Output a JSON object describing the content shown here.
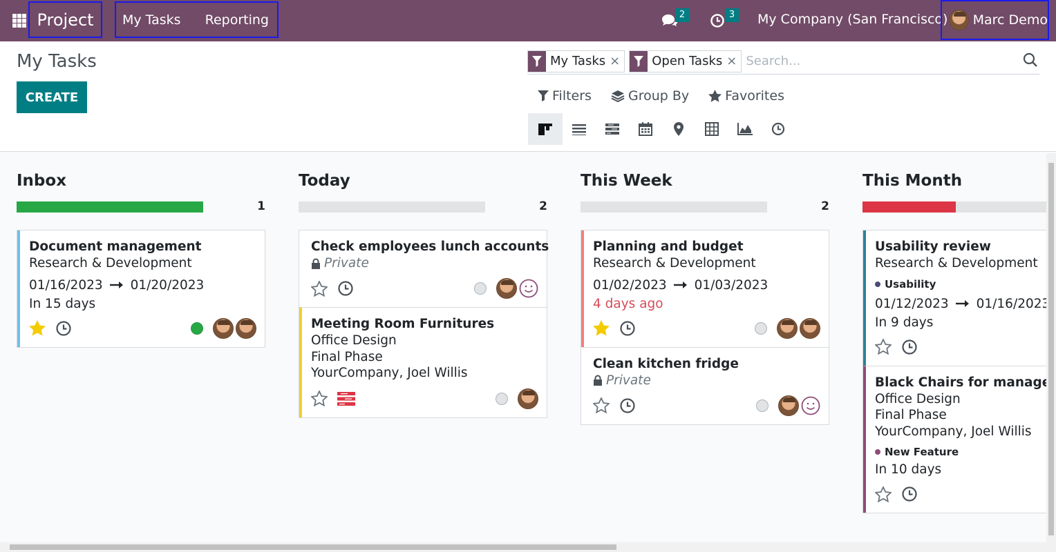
{
  "navbar": {
    "brand": "Project",
    "menu": [
      "My Tasks",
      "Reporting"
    ],
    "messages_count": "2",
    "activities_count": "3",
    "company": "My Company (San Francisco)",
    "user": "Marc Demo",
    "icons": [
      "apps-grid-icon",
      "chat-icon",
      "clock-icon"
    ]
  },
  "control_panel": {
    "title": "My Tasks",
    "create_label": "CREATE",
    "facets": [
      "My Tasks",
      "Open Tasks"
    ],
    "search_placeholder": "Search...",
    "filters_label": "Filters",
    "groupby_label": "Group By",
    "favorites_label": "Favorites",
    "views": [
      "kanban",
      "list",
      "gantt",
      "calendar",
      "map",
      "pivot",
      "graph",
      "activity"
    ],
    "active_view": "kanban"
  },
  "columns": [
    {
      "title": "Inbox",
      "count": "1",
      "progress": [
        {
          "color": "#28a745",
          "fraction": 1.0
        }
      ],
      "cards": [
        {
          "title": "Document management",
          "lines": [
            "Research & Development"
          ],
          "date_start": "01/16/2023",
          "date_end": "01/20/2023",
          "deadline": "In 15 days",
          "starred": true,
          "state": "green",
          "avatars": 2,
          "accent": "#6cc1ed"
        }
      ]
    },
    {
      "title": "Today",
      "count": "2",
      "progress": [],
      "cards": [
        {
          "title": "Check employees lunch accounts",
          "private": "Private",
          "starred": false,
          "state": "grey",
          "avatars": 1,
          "smiley": true,
          "accent": "transparent"
        },
        {
          "title": "Meeting Room Furnitures",
          "lines": [
            "Office Design",
            "Final Phase",
            "YourCompany, Joel Willis"
          ],
          "starred": false,
          "state": "grey",
          "avatars": 1,
          "gantt_icon": true,
          "accent": "#f4cf2c"
        }
      ]
    },
    {
      "title": "This Week",
      "count": "2",
      "progress": [],
      "cards": [
        {
          "title": "Planning and budget",
          "lines": [
            "Research & Development"
          ],
          "date_start": "01/02/2023",
          "date_end": "01/03/2023",
          "deadline": "4 days ago",
          "overdue": true,
          "starred": true,
          "state": "grey",
          "avatars": 2,
          "accent": "#f08080"
        },
        {
          "title": "Clean kitchen fridge",
          "private": "Private",
          "starred": false,
          "state": "grey",
          "avatars": 1,
          "smiley": true,
          "accent": "transparent"
        }
      ]
    },
    {
      "title": "This Month",
      "count": "",
      "progress": [
        {
          "color": "#dc3545",
          "fraction": 0.5
        }
      ],
      "cards": [
        {
          "title": "Usability review",
          "lines": [
            "Research & Development"
          ],
          "tag": "Usability",
          "tag_color": "#4c4c7a",
          "date_start": "01/12/2023",
          "date_end": "01/16/2023",
          "deadline": "In 9 days",
          "starred": false,
          "state": "grey",
          "avatars": 0,
          "accent": "#2c8397"
        },
        {
          "title": "Black Chairs for managers",
          "lines": [
            "Office Design",
            "Final Phase",
            "YourCompany, Joel Willis"
          ],
          "tag": "New Feature",
          "tag_color": "#8e4c77",
          "deadline": "In 10 days",
          "starred": false,
          "state": "none",
          "avatars": 0,
          "accent": "#8e4c77"
        }
      ]
    }
  ],
  "colors": {
    "navbar": "#714b67",
    "primary": "#017e84",
    "overdue": "#d44c59"
  }
}
